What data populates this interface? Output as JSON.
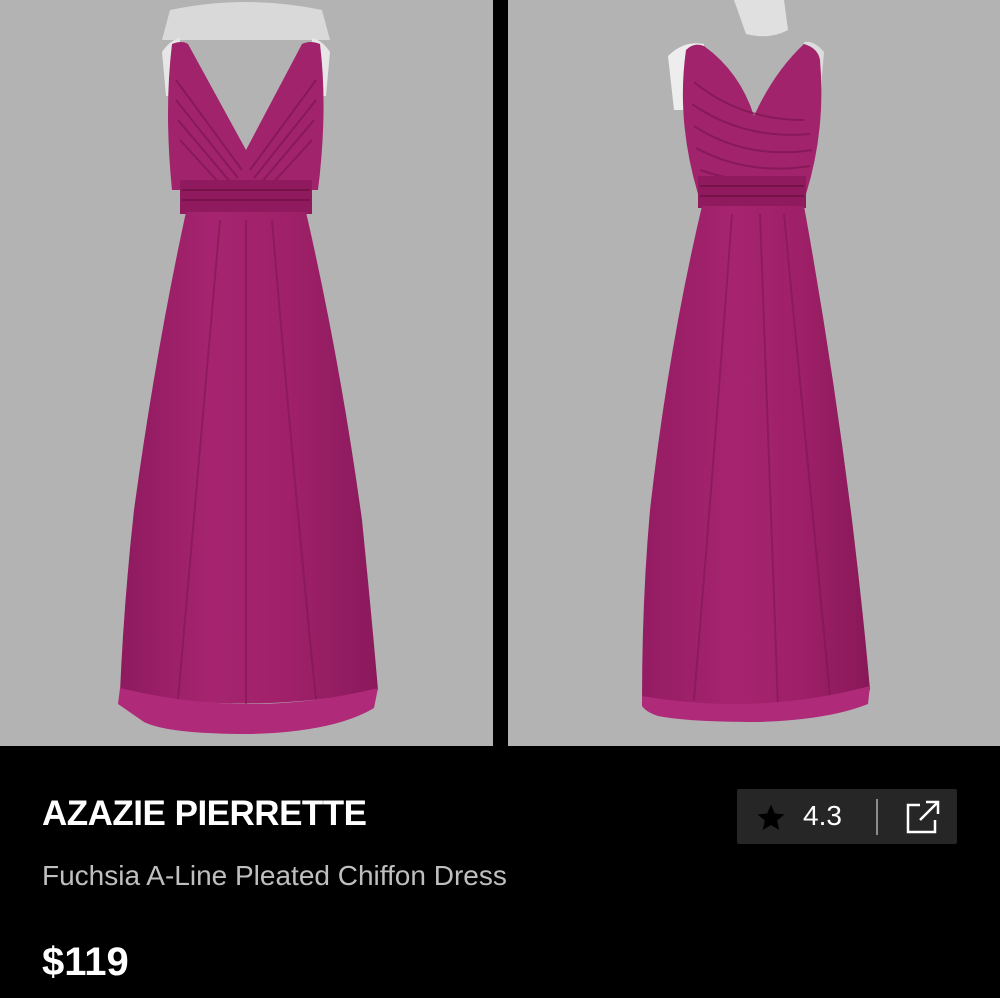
{
  "gallery": {
    "images": [
      {
        "label": "dress back view"
      },
      {
        "label": "dress front view"
      }
    ]
  },
  "colors": {
    "background": "#000000",
    "photo_background": "#b3b3b3",
    "dress": "#a3226e",
    "action_bar": "#262626",
    "subtitle": "#bfbfbf"
  },
  "product": {
    "brand": "AZAZIE PIERRETTE",
    "name": "Fuchsia A-Line Pleated Chiffon Dress",
    "price": "$119"
  },
  "actions": {
    "rating": "4.3",
    "rating_icon": "star-icon",
    "open_icon": "external-link-icon"
  }
}
